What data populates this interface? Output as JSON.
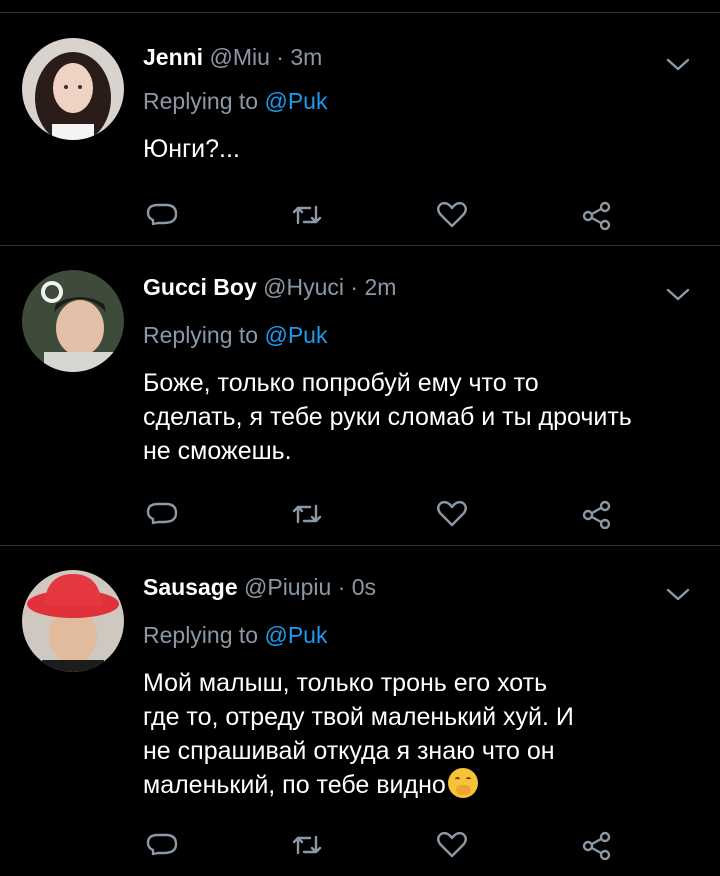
{
  "colors": {
    "background": "#000000",
    "secondary_text": "#8b98a5",
    "mention": "#1d9bf0",
    "divider": "#2f3336"
  },
  "replying_prefix": "Replying to",
  "tweets": [
    {
      "name": "Jenni",
      "handle": "@Miu",
      "dot": "·",
      "time": "3m",
      "reply_to": "@Puk",
      "text_lines": [
        "Юнги?..."
      ]
    },
    {
      "name": "Gucci Boy",
      "handle": "@Hyuci",
      "dot": "·",
      "time": "2m",
      "reply_to": "@Puk",
      "text_lines": [
        "Боже, только попробуй ему что то",
        "сделать, я тебе руки сломаб и ты дрочить",
        "не сможешь."
      ]
    },
    {
      "name": "Sausage",
      "handle": "@Piupiu",
      "dot": "·",
      "time": "0s",
      "reply_to": "@Puk",
      "text_lines": [
        "Мой малыш, только тронь его хоть",
        "где то, отреду твой маленький хуй. И",
        "не спрашивай откуда я знаю что он",
        "маленький, по тебе видно"
      ],
      "trailing_emoji": "hand-over-mouth-emoji"
    }
  ],
  "action_icons": [
    "reply-icon",
    "retweet-icon",
    "like-icon",
    "share-icon"
  ]
}
